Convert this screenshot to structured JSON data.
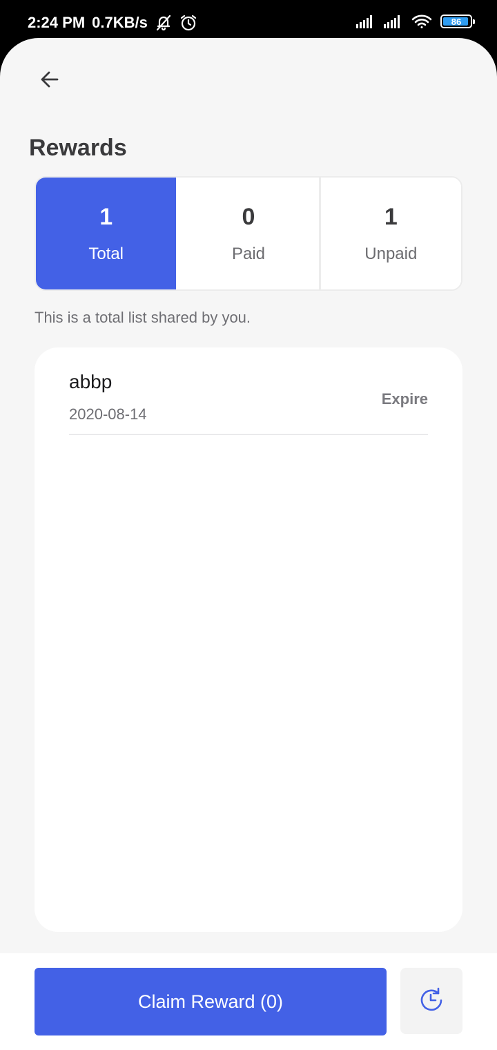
{
  "status_bar": {
    "time": "2:24 PM",
    "net_speed": "0.7KB/s",
    "battery_level": "86",
    "icons": [
      "notifications-off-icon",
      "alarm-icon",
      "signal-icon",
      "signal-icon",
      "wifi-icon",
      "battery-icon"
    ]
  },
  "header": {
    "back_icon": "arrow-left-icon",
    "title": "Rewards"
  },
  "stats": [
    {
      "value": "1",
      "label": "Total",
      "active": true
    },
    {
      "value": "0",
      "label": "Paid",
      "active": false
    },
    {
      "value": "1",
      "label": "Unpaid",
      "active": false
    }
  ],
  "caption": "This is a total list shared by you.",
  "list": [
    {
      "name": "abbp",
      "date": "2020-08-14",
      "status": "Expire"
    }
  ],
  "bottom": {
    "claim_label": "Claim Reward (0)",
    "history_icon": "history-icon"
  },
  "colors": {
    "accent": "#4361e6",
    "background": "#f6f6f6",
    "card": "#ffffff"
  }
}
